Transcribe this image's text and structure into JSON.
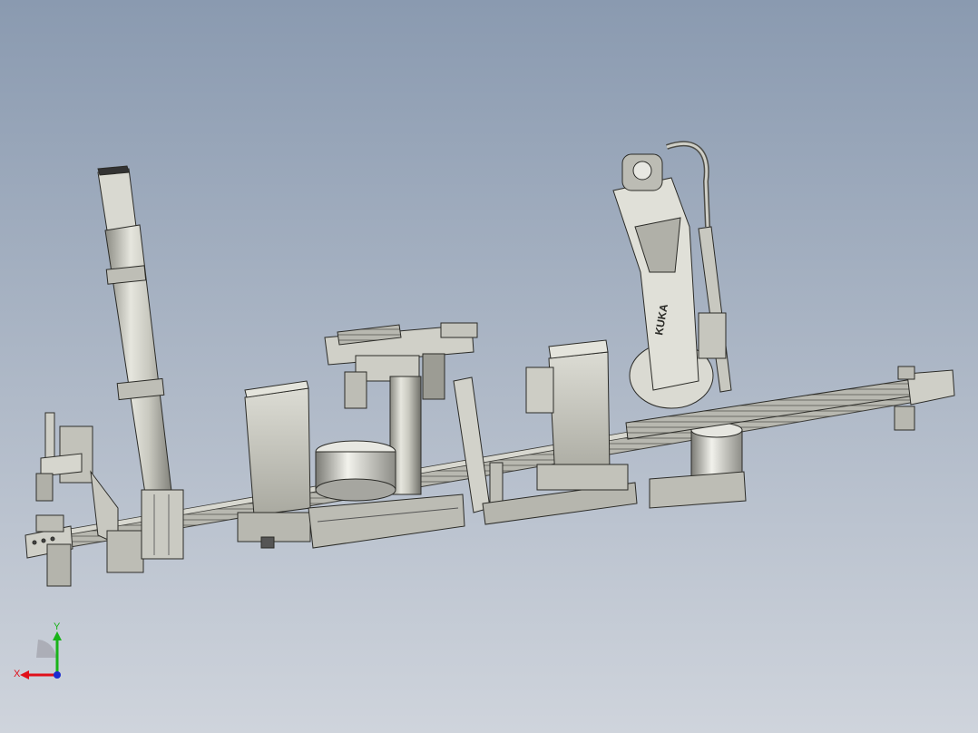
{
  "viewport": {
    "background_top": "#8a9ab0",
    "background_bottom": "#cfd4dc"
  },
  "model": {
    "robot_brand_text": "KUKA"
  },
  "triad": {
    "x_label": "X",
    "y_label": "Y",
    "x_color": "#e0101a",
    "y_color": "#19b319",
    "z_color": "#1a2ad0"
  }
}
